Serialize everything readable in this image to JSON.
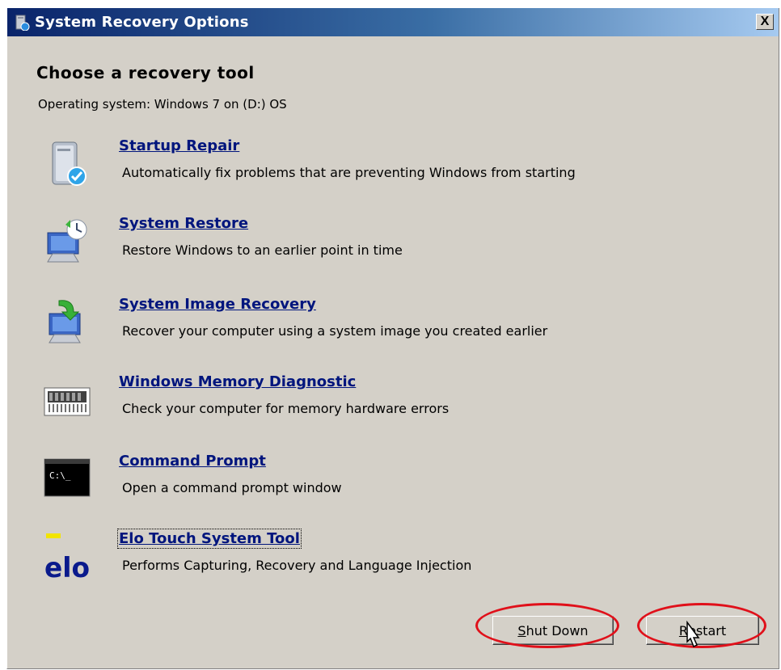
{
  "window": {
    "title": "System Recovery Options",
    "close_label": "X"
  },
  "heading": "Choose a recovery tool",
  "os_line": "Operating system: Windows 7 on (D:) OS",
  "tools": [
    {
      "title": "Startup Repair",
      "desc": "Automatically fix problems that are preventing Windows from starting",
      "icon": "startup-repair-icon"
    },
    {
      "title": "System Restore",
      "desc": "Restore Windows to an earlier point in time",
      "icon": "system-restore-icon"
    },
    {
      "title": "System Image Recovery",
      "desc": "Recover your computer using a system image you created earlier",
      "icon": "system-image-recovery-icon"
    },
    {
      "title": "Windows Memory Diagnostic",
      "desc": "Check your computer for memory hardware errors",
      "icon": "memory-chip-icon"
    },
    {
      "title": "Command Prompt",
      "desc": "Open a command prompt window",
      "icon": "command-prompt-icon"
    },
    {
      "title": "Elo Touch System Tool",
      "desc": "Performs Capturing, Recovery and Language Injection",
      "icon": "elo-logo-icon"
    }
  ],
  "cmd_icon_text": "C:\\_",
  "elo_logo_text": "elo",
  "buttons": {
    "shutdown": {
      "pre": "",
      "ul": "S",
      "post": "hut Down"
    },
    "restart": {
      "pre": "",
      "ul": "R",
      "post": "estart"
    }
  },
  "colors": {
    "link": "#00157d",
    "annotation": "#e0101a",
    "face": "#d4d0c8"
  }
}
